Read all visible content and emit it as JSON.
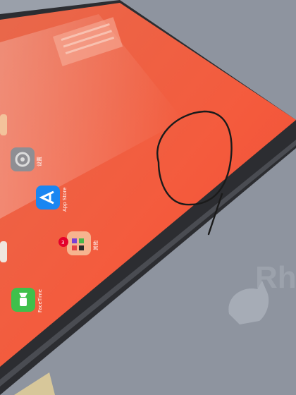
{
  "photo": {
    "subject": "tablet-screen-with-hand-drawn-circle",
    "screen_color": "#f25a3a",
    "bezel_color": "#2a2b2e",
    "backdrop_color": "#8d94a0",
    "circle_stroke_color": "#1b1b1b"
  },
  "home_screen": {
    "apps": [
      {
        "label": "设置",
        "icon": "settings-gear-icon"
      },
      {
        "label": "App Store",
        "icon": "app-store-icon"
      },
      {
        "label": "其他",
        "icon": "folder-icon",
        "badge": "3"
      },
      {
        "label": "FaceTime",
        "icon": "facetime-icon"
      }
    ]
  },
  "watermark": {
    "text": "Rh",
    "icon": "rhino-logo-icon"
  }
}
